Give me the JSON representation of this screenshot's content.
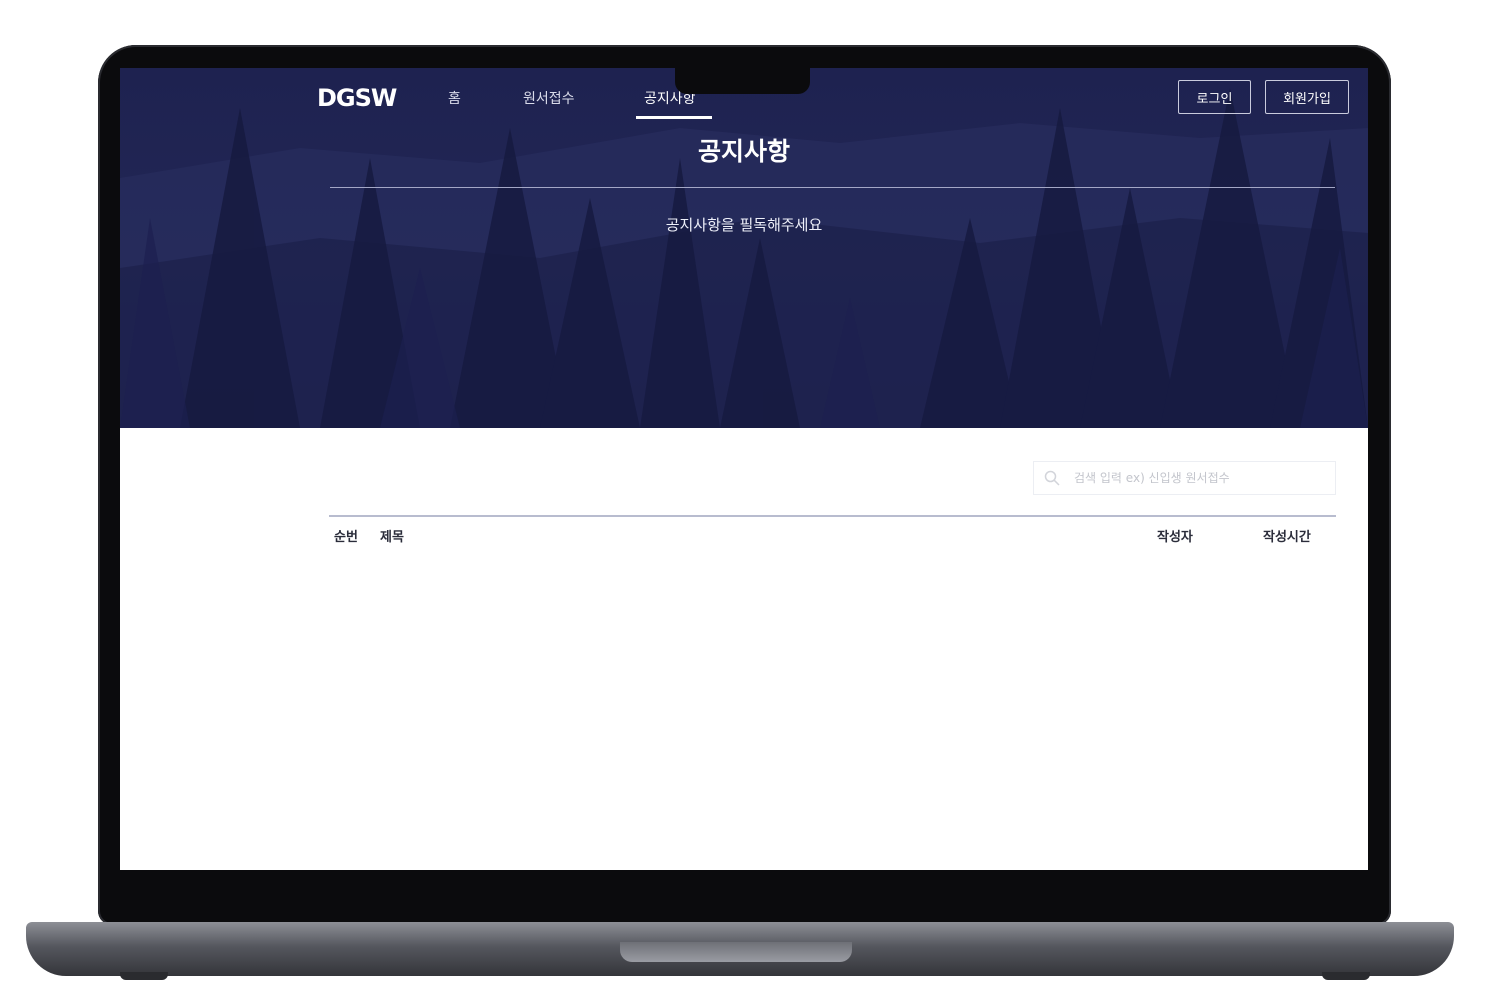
{
  "nav": {
    "logo": "DGSW",
    "items": [
      {
        "label": "홈"
      },
      {
        "label": "원서접수"
      },
      {
        "label": "공지사항",
        "active": true
      }
    ],
    "login_label": "로그인",
    "signup_label": "회원가입"
  },
  "hero": {
    "title": "공지사항",
    "subtitle": "공지사항을 필독해주세요"
  },
  "search": {
    "placeholder": "검색 입력 ex) 신입생 원서접수",
    "value": ""
  },
  "table": {
    "columns": [
      "순번",
      "제목",
      "작성자",
      "작성시간"
    ],
    "rows": []
  },
  "colors": {
    "hero_bg": "#222756",
    "accent": "#ffffff"
  }
}
